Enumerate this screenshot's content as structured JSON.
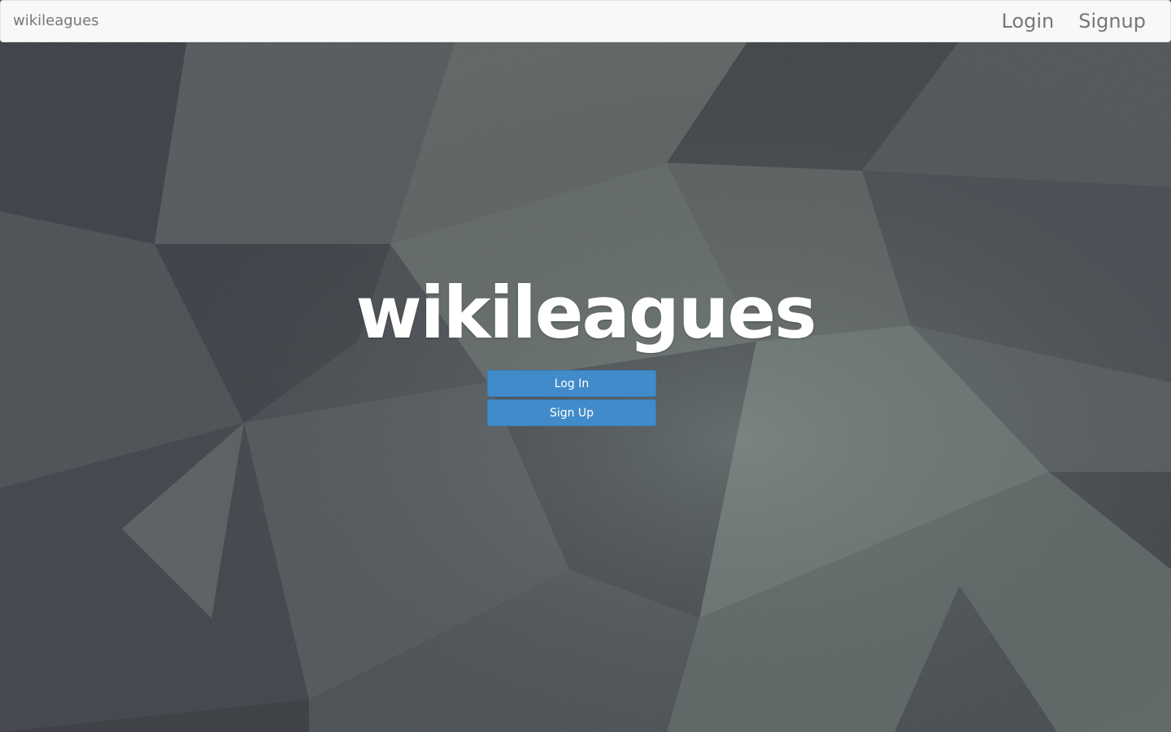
{
  "navbar": {
    "brand": "wikileagues",
    "links": [
      {
        "label": "Login"
      },
      {
        "label": "Signup"
      }
    ]
  },
  "hero": {
    "title": "wikileagues",
    "buttons": [
      {
        "label": "Log In"
      },
      {
        "label": "Sign Up"
      }
    ]
  },
  "colors": {
    "primary_button": "#428bca",
    "navbar_bg": "#f8f8f8",
    "navbar_text": "#777777",
    "hero_text": "#ffffff",
    "background": "#4a4e53"
  }
}
